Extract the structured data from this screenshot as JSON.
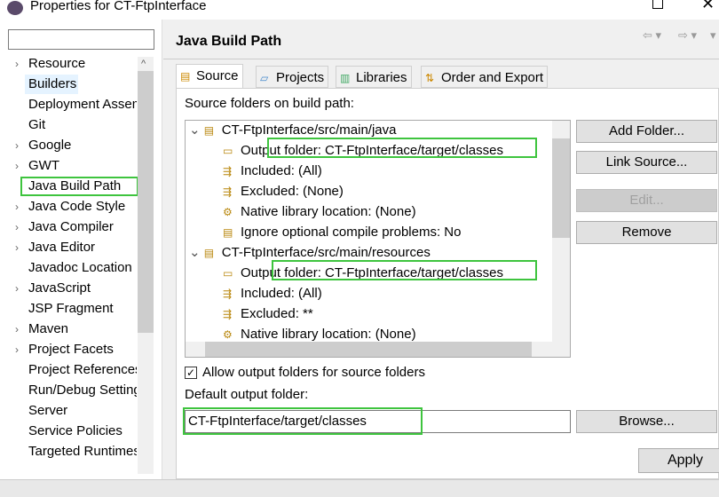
{
  "window": {
    "title": "Properties for CT-FtpInterface"
  },
  "filter": {
    "value": ""
  },
  "nav": [
    {
      "label": "Resource",
      "expandable": true
    },
    {
      "label": "Builders",
      "expandable": false,
      "hover": true
    },
    {
      "label": "Deployment Assembly",
      "expandable": false
    },
    {
      "label": "Git",
      "expandable": false
    },
    {
      "label": "Google",
      "expandable": true
    },
    {
      "label": "GWT",
      "expandable": true
    },
    {
      "label": "Java Build Path",
      "expandable": false,
      "selected": true
    },
    {
      "label": "Java Code Style",
      "expandable": true
    },
    {
      "label": "Java Compiler",
      "expandable": true
    },
    {
      "label": "Java Editor",
      "expandable": true
    },
    {
      "label": "Javadoc Location",
      "expandable": false
    },
    {
      "label": "JavaScript",
      "expandable": true
    },
    {
      "label": "JSP Fragment",
      "expandable": false
    },
    {
      "label": "Maven",
      "expandable": true
    },
    {
      "label": "Project Facets",
      "expandable": true
    },
    {
      "label": "Project References",
      "expandable": false
    },
    {
      "label": "Run/Debug Settings",
      "expandable": false
    },
    {
      "label": "Server",
      "expandable": false
    },
    {
      "label": "Service Policies",
      "expandable": false
    },
    {
      "label": "Targeted Runtimes",
      "expandable": false
    }
  ],
  "page": {
    "title": "Java Build Path"
  },
  "tabs": [
    {
      "label": "Source",
      "active": true
    },
    {
      "label": "Projects"
    },
    {
      "label": "Libraries"
    },
    {
      "label": "Order and Export"
    }
  ],
  "source": {
    "label": "Source folders on build path:",
    "tree": [
      {
        "level": 0,
        "text": "CT-FtpInterface/src/main/java",
        "icon": "source-folder"
      },
      {
        "level": 1,
        "text": "Output folder: CT-FtpInterface/target/classes",
        "icon": "output-folder"
      },
      {
        "level": 1,
        "text": "Included: (All)",
        "icon": "included"
      },
      {
        "level": 1,
        "text": "Excluded: (None)",
        "icon": "excluded"
      },
      {
        "level": 1,
        "text": "Native library location: (None)",
        "icon": "native-library"
      },
      {
        "level": 1,
        "text": "Ignore optional compile problems: No",
        "icon": "ignore-problems"
      },
      {
        "level": 0,
        "text": "CT-FtpInterface/src/main/resources",
        "icon": "source-folder"
      },
      {
        "level": 1,
        "text": "Output folder: CT-FtpInterface/target/classes",
        "icon": "output-folder"
      },
      {
        "level": 1,
        "text": "Included: (All)",
        "icon": "included"
      },
      {
        "level": 1,
        "text": "Excluded: **",
        "icon": "excluded"
      },
      {
        "level": 1,
        "text": "Native library location: (None)",
        "icon": "native-library"
      }
    ],
    "buttons": {
      "add": "Add Folder...",
      "link": "Link Source...",
      "edit": "Edit...",
      "remove": "Remove"
    },
    "allow_output": {
      "label": "Allow output folders for source folders",
      "checked": true
    },
    "default_output": {
      "label": "Default output folder:",
      "value": "CT-FtpInterface/target/classes"
    },
    "browse": "Browse..."
  },
  "apply": "Apply",
  "colors": {
    "highlight": "#3ec43e"
  }
}
